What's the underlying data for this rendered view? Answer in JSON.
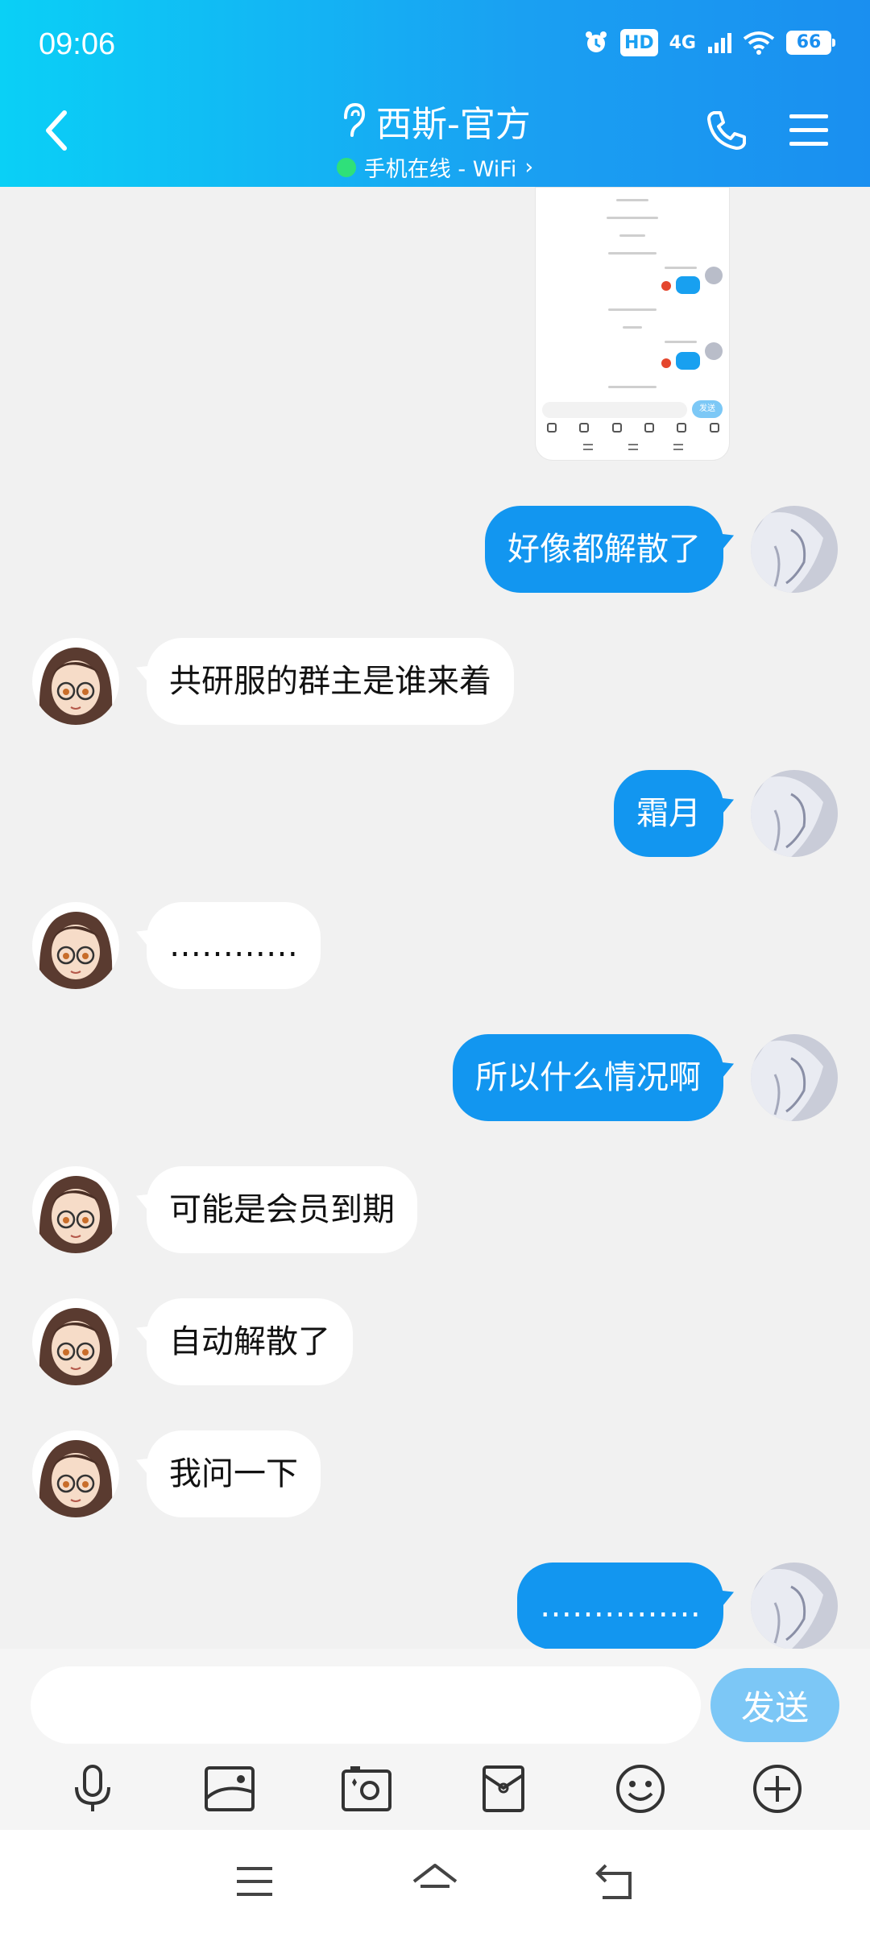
{
  "status_bar": {
    "time": "09:06",
    "network": "4G",
    "hd": "HD",
    "battery": "66"
  },
  "header": {
    "title": "西斯-官方",
    "subtitle": "手机在线 - WiFi",
    "chevron": "›",
    "icons": {
      "back": "chevron-left-icon",
      "ear": "ear-icon",
      "phone": "phone-icon",
      "menu": "menu-icon"
    }
  },
  "messages": [
    {
      "from": "me",
      "text": "好像都解散了"
    },
    {
      "from": "other",
      "text": "共研服的群主是谁来着"
    },
    {
      "from": "me",
      "text": "霜月"
    },
    {
      "from": "other",
      "text": "…………"
    },
    {
      "from": "me",
      "text": "所以什么情况啊"
    },
    {
      "from": "other",
      "text": "可能是会员到期"
    },
    {
      "from": "other",
      "text": "自动解散了"
    },
    {
      "from": "other",
      "text": "我问一下"
    },
    {
      "from": "me",
      "text": "……………"
    }
  ],
  "thumbnail": {
    "send_label": "发送"
  },
  "input": {
    "value": "",
    "placeholder": "",
    "send_label": "发送"
  },
  "toolbar": [
    "microphone-icon",
    "image-icon",
    "camera-icon",
    "red-packet-icon",
    "emoji-icon",
    "plus-icon"
  ],
  "colors": {
    "accent": "#1296f0",
    "header_start": "#0ad0f6",
    "send_disabled": "#7cc7f6"
  }
}
